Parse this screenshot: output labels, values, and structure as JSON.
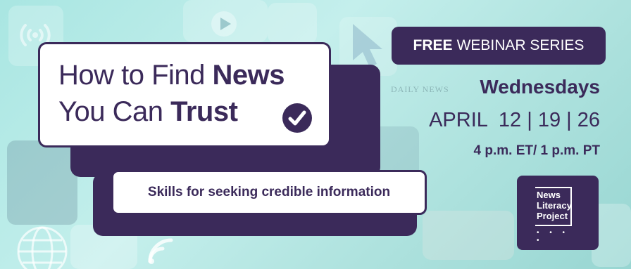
{
  "headline": {
    "line1_regular": "How to Find ",
    "line1_bold": "News",
    "line2_regular": "You Can ",
    "line2_bold": "Trust"
  },
  "subheadline": "Skills for seeking credible information",
  "series_badge": {
    "bold": "FREE",
    "rest": "WEBINAR SERIES"
  },
  "schedule": {
    "days": "Wednesdays",
    "dates": "APRIL  12 | 19 | 26",
    "times": "4 p.m. ET/ 1 p.m. PT"
  },
  "background_text": "DAILY NEWS",
  "logo": {
    "line1": "News",
    "line2": "Literacy",
    "line3": "Project",
    "dots": "• • • •"
  },
  "icons": [
    "checkmark-icon",
    "broadcast-icon",
    "play-icon",
    "cursor-icon",
    "globe-icon",
    "wifi-icon"
  ],
  "colors": {
    "primary": "#3b2a5a",
    "background": "#b5ebe7",
    "card": "#ffffff"
  }
}
